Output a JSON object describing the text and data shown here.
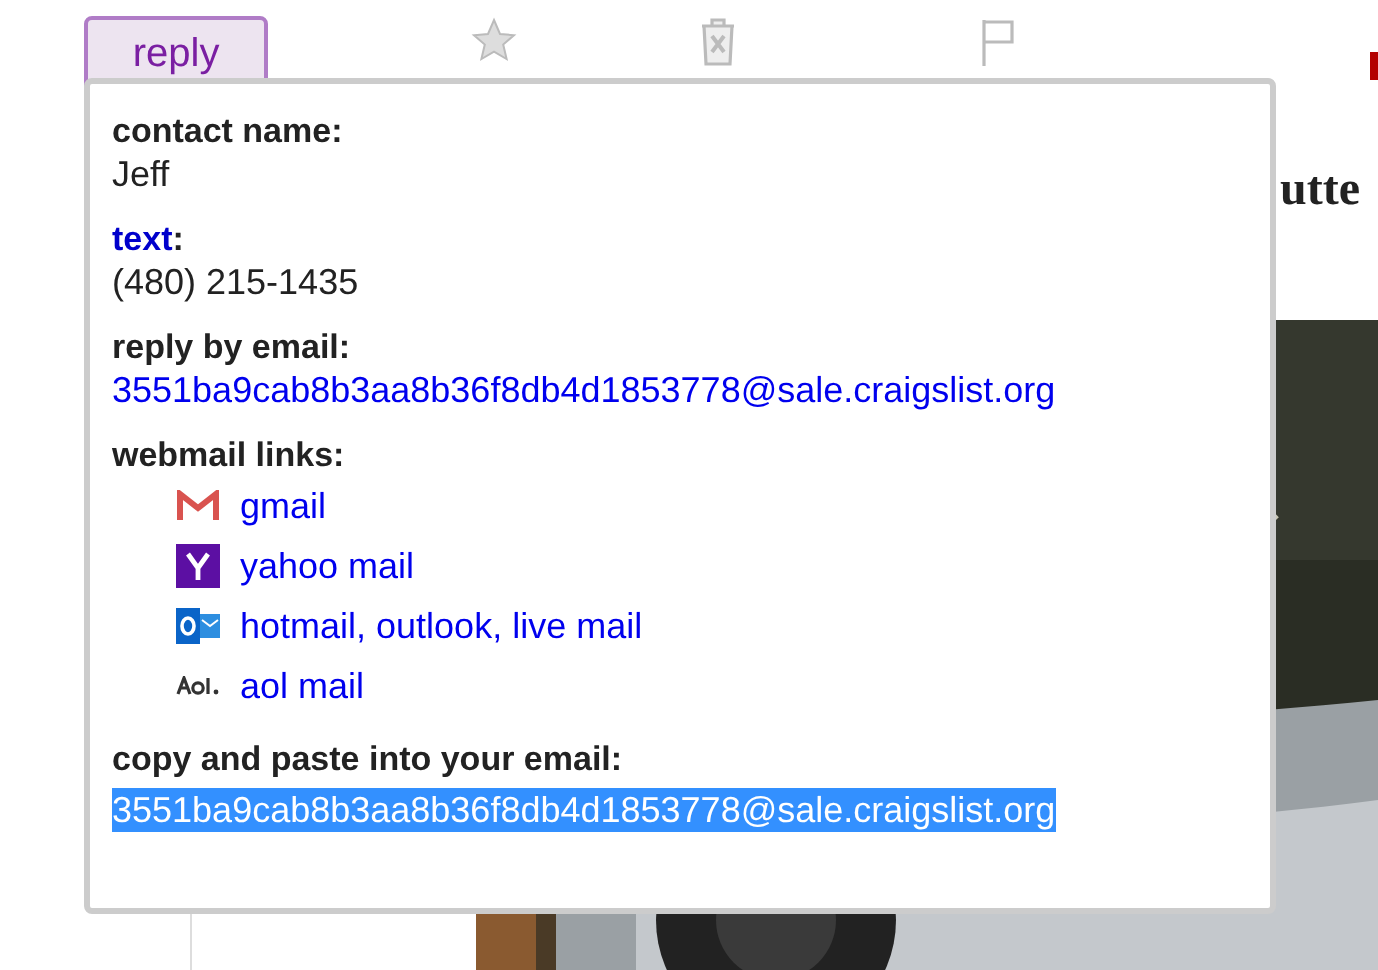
{
  "toolbar": {
    "reply_button": "reply"
  },
  "heading": "utte",
  "reply_popup": {
    "contact_name_label": "contact name:",
    "contact_name": "Jeff",
    "text_label": "text",
    "text_colon": ":",
    "phone": "(480) 215-1435",
    "reply_by_email_label": "reply by email:",
    "email": "3551ba9cab8b3aa8b36f8db4d1853778@sale.craigslist.org",
    "webmail_label": "webmail links:",
    "webmail_links": [
      {
        "kind": "gmail",
        "label": "gmail"
      },
      {
        "kind": "yahoo",
        "label": "yahoo mail"
      },
      {
        "kind": "outlook",
        "label": "hotmail, outlook, live mail"
      },
      {
        "kind": "aol",
        "label": "aol mail"
      }
    ],
    "copy_label": "copy and paste into your email:",
    "copy_email": "3551ba9cab8b3aa8b36f8db4d1853778@sale.craigslist.org",
    "copy_email_selected": true
  }
}
